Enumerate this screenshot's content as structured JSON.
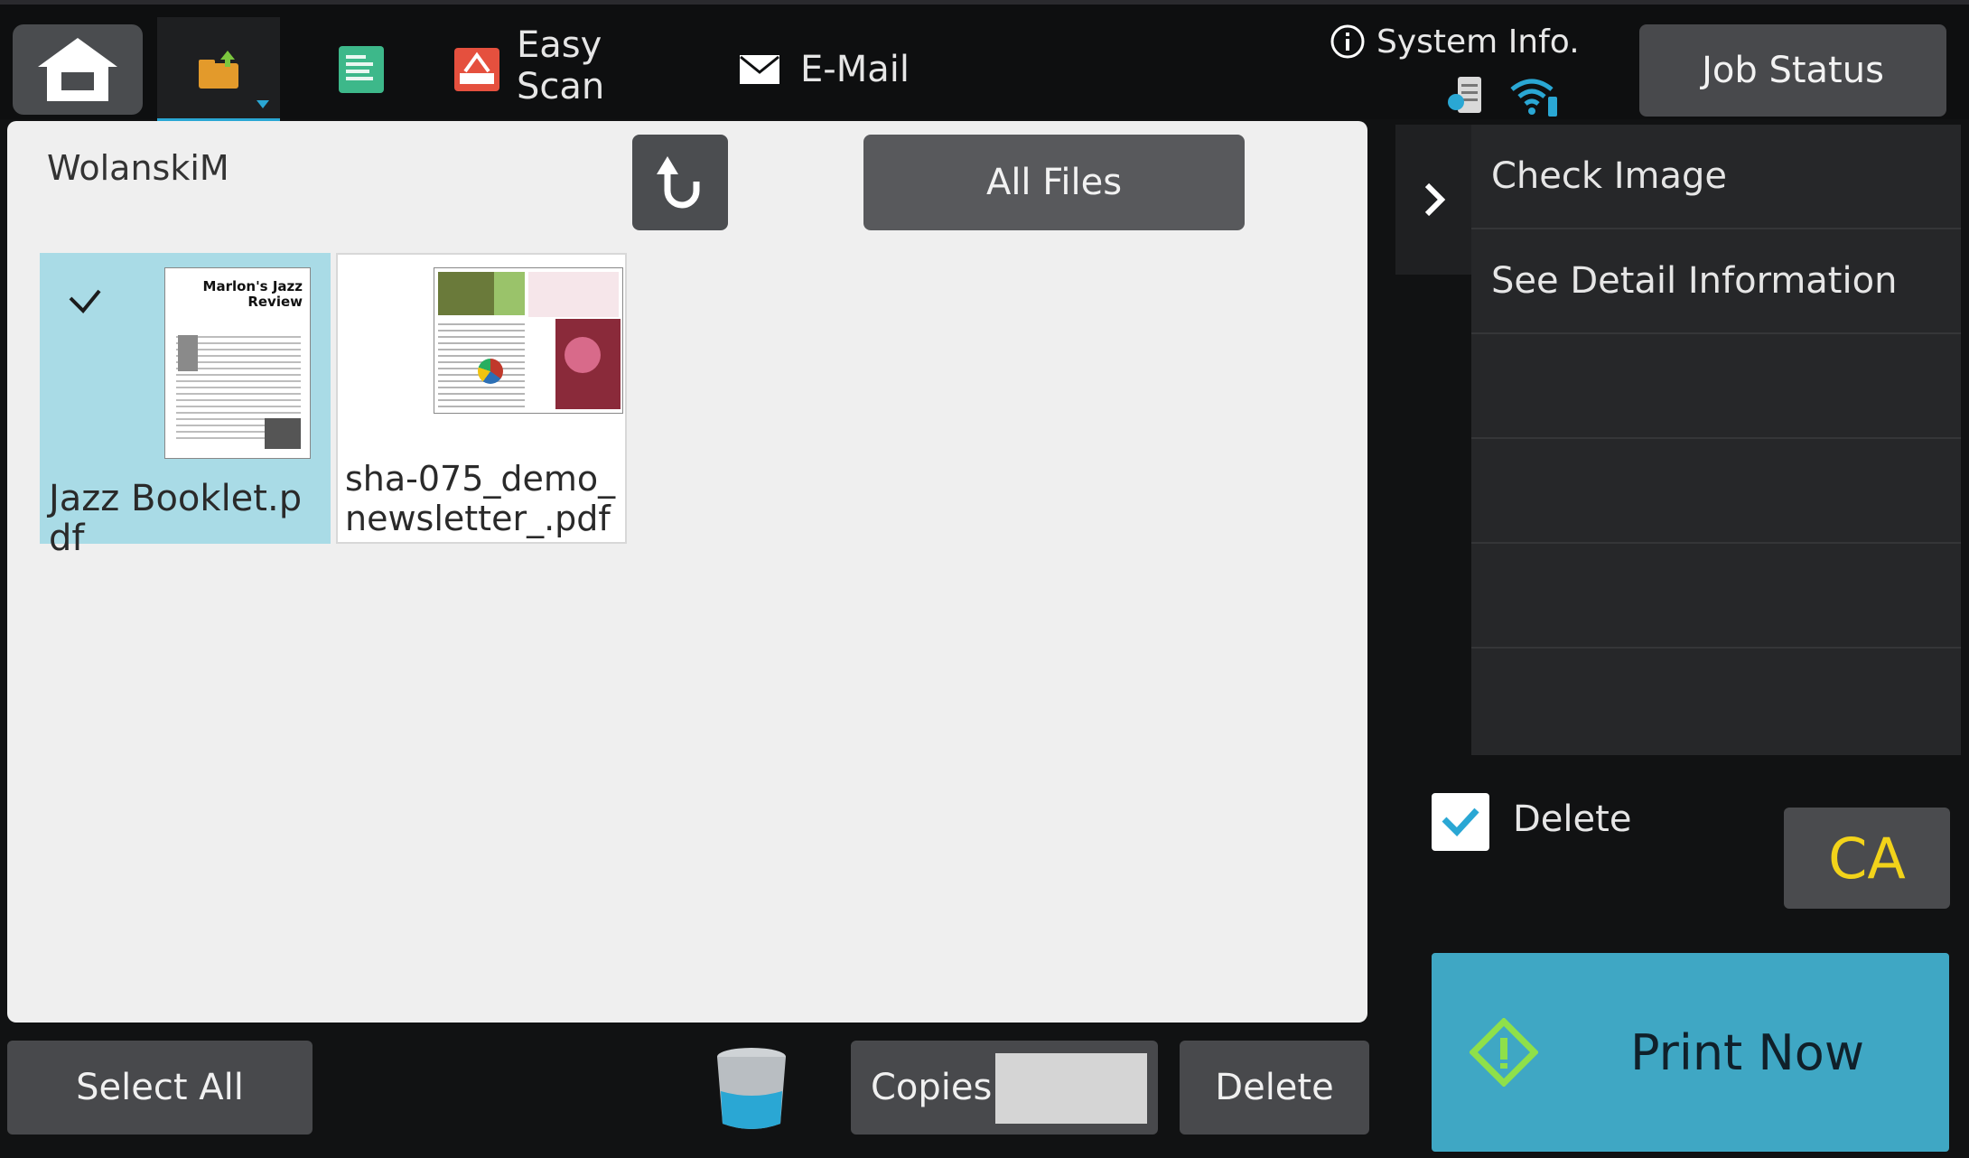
{
  "topbar": {
    "easy_scan_line1": "Easy",
    "easy_scan_line2": "Scan",
    "email_label": "E-Mail",
    "system_info_label": "System Info.",
    "job_status_label": "Job Status"
  },
  "file_panel": {
    "user": "WolanskiM",
    "all_files_label": "All Files",
    "files": [
      {
        "name": "Jazz Booklet.pdf",
        "selected": true,
        "thumb_title_line1": "Marlon's Jazz",
        "thumb_title_line2": "Review"
      },
      {
        "name": "sha-075_demo_newsletter_.pdf",
        "selected": false
      }
    ]
  },
  "side_menu": {
    "items": [
      "Check Image",
      "See Detail Information",
      "",
      "",
      "",
      ""
    ]
  },
  "options": {
    "delete_checkbox_label": "Delete",
    "delete_checked": true,
    "ca_label": "CA",
    "print_now_label": "Print Now"
  },
  "bottom": {
    "select_all_label": "Select All",
    "copies_label": "Copies",
    "copies_value": "",
    "delete_label": "Delete"
  },
  "colors": {
    "accent": "#2aa7d4",
    "selected_tile": "#a9dbe6",
    "print_button": "#3fa7c4",
    "ca_text": "#f2d31a"
  }
}
